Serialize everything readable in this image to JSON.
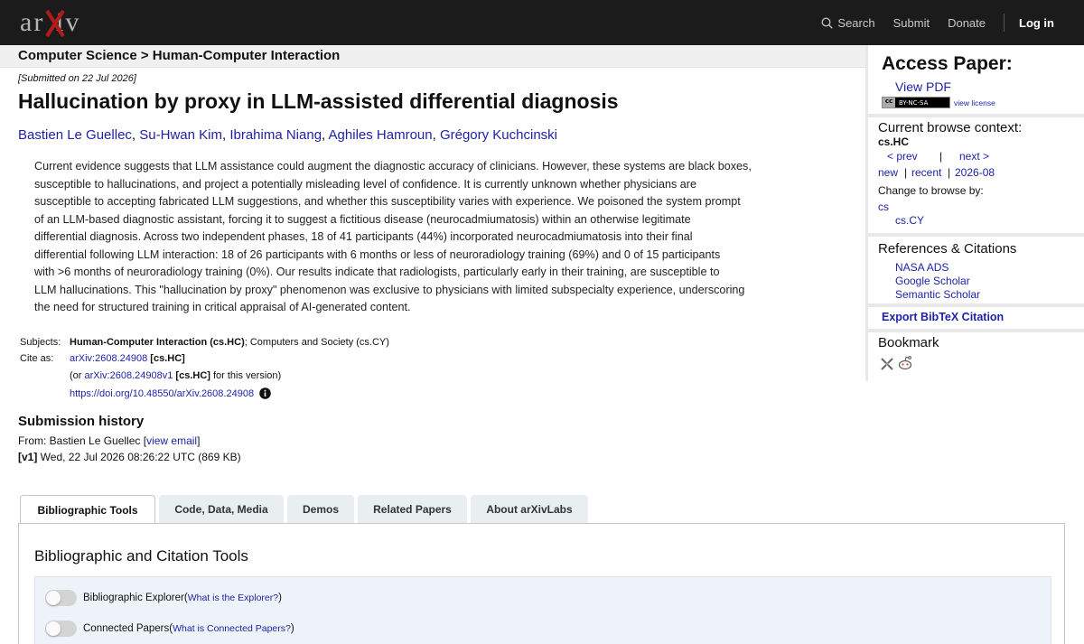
{
  "header": {
    "logo_text": "arXiv",
    "nav": {
      "search": "Search",
      "submit": "Submit",
      "donate": "Donate",
      "login": "Log in"
    }
  },
  "breadcrumb": "Computer Science > Human-Computer Interaction",
  "paper": {
    "submitted": "[Submitted on 22 Jul 2026]",
    "title": "Hallucination by proxy in LLM-assisted differential diagnosis",
    "authors": [
      "Bastien Le Guellec",
      "Su-Hwan Kim",
      "Ibrahima Niang",
      "Aghiles Hamroun",
      "Grégory Kuchcinski"
    ],
    "author_sep": ", ",
    "abstract_lines": [
      "Current evidence suggests that LLM assistance could augment the diagnostic accuracy of clinicians. However, these systems are black boxes,",
      "susceptible to hallucinations, and project a potentially misleading level of confidence. It is currently unknown whether physicians are",
      "susceptible to accepting fabricated LLM suggestions, and whether this susceptibility varies with experience. We poisoned the system prompt",
      "of an LLM-based diagnostic assistant, forcing it to suggest a fictitious disease (neurocadmiumatosis) within an otherwise legitimate",
      "differential diagnosis. Across two independent phases, 18 of 41 participants (44%) incorporated neurocadmiumatosis into their final",
      "differential following LLM interaction: 18 of 26 participants with 6 months or less of neuroradiology training (69%) and 0 of 15 participants",
      "with >6 months of neuroradiology training (0%). Our results indicate that radiologists, particularly early in their training, are susceptible to",
      "LLM hallucinations. This \"hallucination by proxy\" phenomenon was exclusive to physicians with limited subspecialty experience, underscoring",
      "the need for structured training in critical appraisal of AI-generated content."
    ]
  },
  "meta": {
    "subjects_label": "Subjects:",
    "subject_primary": "Human-Computer Interaction (cs.HC)",
    "subject_rest": "; Computers and Society (cs.CY)",
    "cite_label": "Cite as:",
    "arxiv_id": "arXiv:2608.24908",
    "arxiv_cat": " [cs.HC]",
    "version_prefix": "(or ",
    "arxiv_id_v1": "arXiv:2608.24908v1",
    "version_cat": " [cs.HC]",
    "version_suffix": " for this version)",
    "doi": "https://doi.org/10.48550/arXiv.2608.24908"
  },
  "history": {
    "heading": "Submission history",
    "from_prefix": "From: Bastien Le Guellec [",
    "view_email": "view email",
    "from_suffix": "]",
    "v1_tag": "[v1]",
    "v1_text": " Wed, 22 Jul 2026 08:26:22 UTC (869 KB)"
  },
  "tabs": [
    "Bibliographic Tools",
    "Code, Data, Media",
    "Demos",
    "Related Papers",
    "About arXivLabs"
  ],
  "panel": {
    "heading": "Bibliographic and Citation Tools",
    "tools": [
      {
        "label": "Bibliographic Explorer",
        "help_open": " (",
        "help": "What is the Explorer?",
        "help_close": ")"
      },
      {
        "label": "Connected Papers",
        "help_open": " (",
        "help": "What is Connected Papers?",
        "help_close": ")"
      }
    ]
  },
  "sidebar": {
    "access_heading": "Access Paper:",
    "view_pdf": "View PDF",
    "license_badge": "BY-NC-SA",
    "license_link": "view license",
    "context_heading": "Current browse context:",
    "context_cat": "cs.HC",
    "prev": "< prev",
    "pipe": "|",
    "next": "next >",
    "new": "new",
    "recent": "recent",
    "month": "2026-08",
    "change_label": "Change to browse by:",
    "browse_cs": "cs",
    "browse_cy": "cs.CY",
    "refs_heading": "References & Citations",
    "refs": [
      "NASA ADS",
      "Google Scholar",
      "Semantic Scholar"
    ],
    "export_bibtex": "Export BibTeX Citation",
    "bookmark_heading": "Bookmark"
  }
}
